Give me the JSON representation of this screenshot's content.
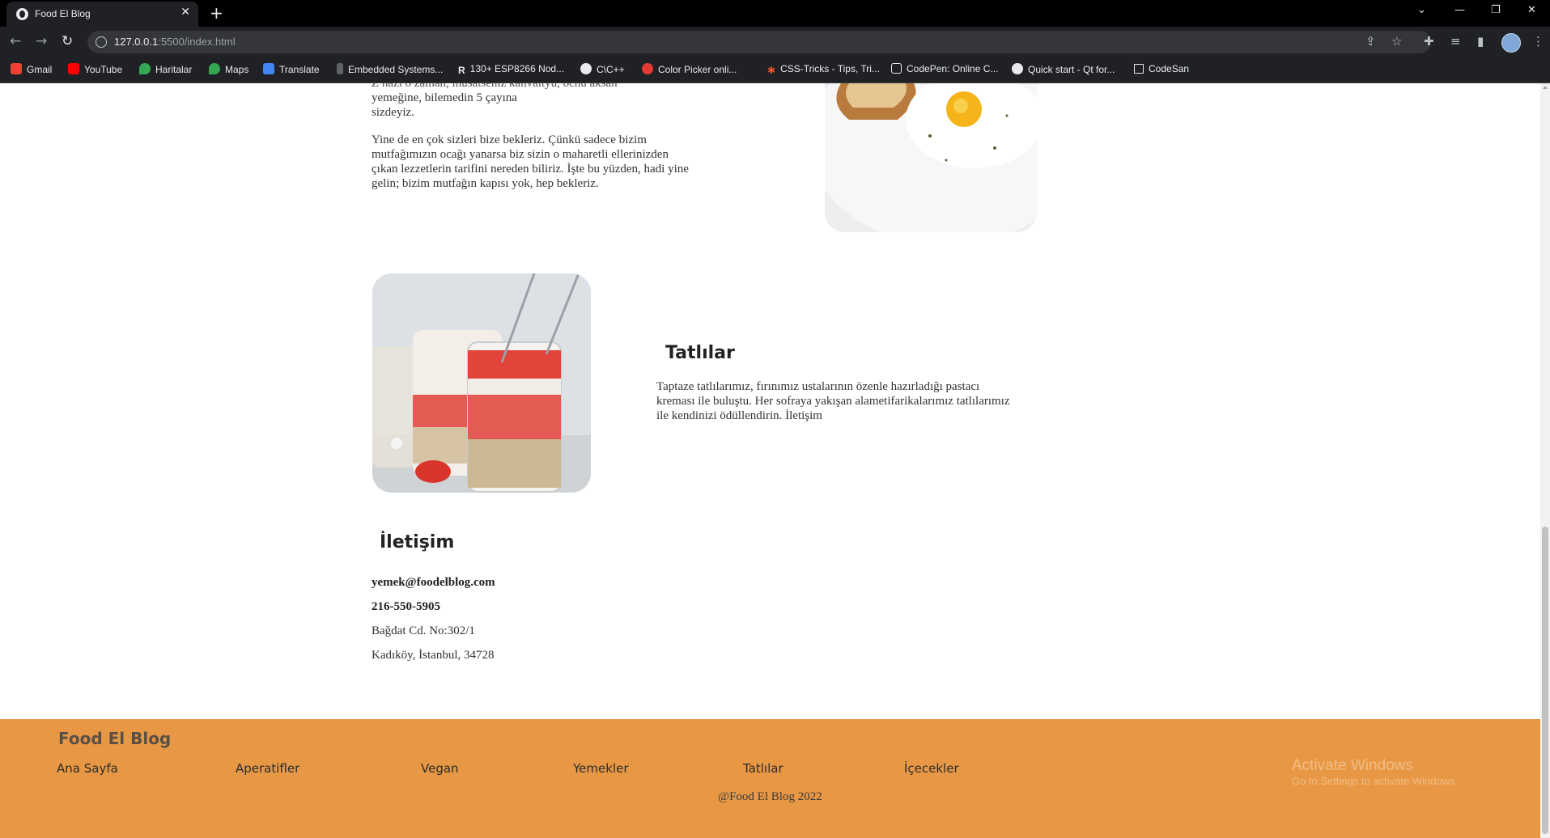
{
  "browser": {
    "tab_title": "Food El Blog",
    "url_host": "127.0.0.1",
    "url_rest": ":5500/index.html",
    "bookmarks": [
      {
        "label": "Gmail",
        "color": "#ea4335"
      },
      {
        "label": "YouTube",
        "color": "#ff0000"
      },
      {
        "label": "Haritalar",
        "color": "#34a853"
      },
      {
        "label": "Maps",
        "color": "#34a853"
      },
      {
        "label": "Translate",
        "color": "#4285f4"
      },
      {
        "label": "Embedded Systems...",
        "color": "#5f6368"
      },
      {
        "label": "130+ ESP8266 Nod...",
        "color": "#3c4043"
      },
      {
        "label": "C\\C++",
        "color": "#e8eaed"
      },
      {
        "label": "Color Picker onli...",
        "color": "#e53935"
      },
      {
        "label": "CSS-Tricks - Tips, Tri...",
        "color": "#e8582c"
      },
      {
        "label": "CodePen: Online C...",
        "color": "#e8eaed"
      },
      {
        "label": "Quick start - Qt for...",
        "color": "#e8eaed"
      },
      {
        "label": "CodeSan",
        "color": "#e8eaed"
      }
    ]
  },
  "intro": {
    "line_partial": "Z nazi o zaman, inusatseniz kanvaityu, ocnu aksan",
    "line1": "yemeğine, bilemedin 5 çayına",
    "line2": "sizdeyiz.",
    "paragraph": "Yine de en çok sizleri bize bekleriz. Çünkü sadece bizim mutfağımızın ocağı yanarsa biz sizin o maharetli ellerinizden çıkan lezzetlerin tarifini nereden biliriz. İşte bu yüzden, hadi yine gelin; bizim mutfağın kapısı yok, hep bekleriz."
  },
  "desserts": {
    "title": "Tatlılar",
    "text": "Taptaze tatlılarımız, fırınımız ustalarının özenle hazırladığı pastacı kreması ile buluştu. Her sofraya yakışan alametifarikalarımız tatlılarımız ile kendinizi ödüllendirin. İletişim"
  },
  "contact": {
    "title": "İletişim",
    "email": "yemek@foodelblog.com",
    "phone": "216-550-5905",
    "address1": "Bağdat Cd. No:302/1",
    "address2": "Kadıköy, İstanbul, 34728"
  },
  "footer": {
    "brand": "Food El Blog",
    "nav": [
      "Ana Sayfa",
      "Aperatifler",
      "Vegan",
      "Yemekler",
      "Tatlılar",
      "İçecekler"
    ],
    "copyright": "@Food El Blog 2022",
    "watermark_title": "Activate Windows",
    "watermark_sub": "Go to Settings to activate Windows.",
    "color": "#e89844"
  }
}
